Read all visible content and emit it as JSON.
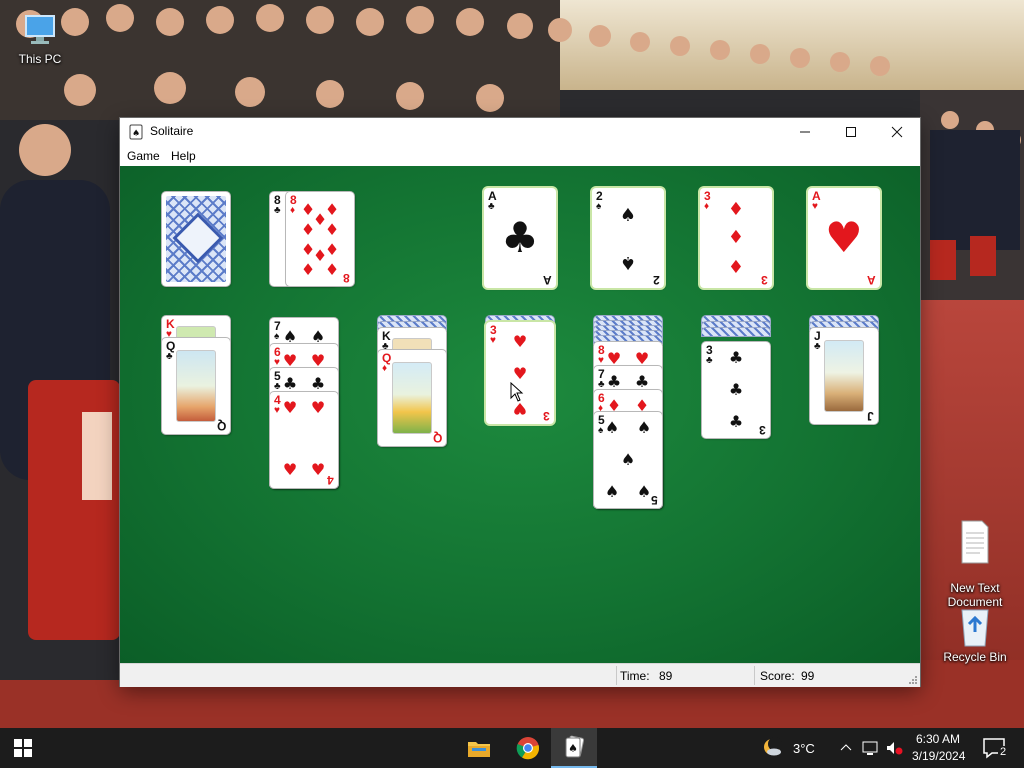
{
  "desktop": {
    "icons": [
      {
        "label": "This PC",
        "icon": "this-pc-icon"
      },
      {
        "label": "New Text\nDocument",
        "icon": "text-document-icon"
      },
      {
        "label": "Recycle Bin",
        "icon": "recycle-bin-icon"
      }
    ]
  },
  "window": {
    "title": "Solitaire",
    "app_icon": "solitaire-card-icon",
    "controls": {
      "minimize": "—",
      "maximize": "☐",
      "close": "✕"
    },
    "menu": [
      "Game",
      "Help"
    ]
  },
  "game": {
    "foundations": [
      {
        "rank": "A",
        "suit": "♣",
        "color": "black"
      },
      {
        "rank": "2",
        "suit": "♠",
        "color": "black"
      },
      {
        "rank": "3",
        "suit": "♦",
        "color": "red"
      },
      {
        "rank": "A",
        "suit": "♥",
        "color": "red"
      }
    ],
    "waste": [
      {
        "rank": "8",
        "suit": "♣"
      },
      {
        "rank": "8",
        "suit": "♦"
      }
    ],
    "tableau": [
      {
        "cards": [
          "K♥",
          "Q♣"
        ]
      },
      {
        "cards": [
          "7♠",
          "6♥",
          "5♣",
          "4♥"
        ]
      },
      {
        "cards": [
          "K♣",
          "Q♦"
        ]
      },
      {
        "cards": [
          "3♥"
        ]
      },
      {
        "cards": [
          "8♥",
          "7♣",
          "6♦",
          "5♠"
        ]
      },
      {
        "cards": [
          "3♣"
        ]
      },
      {
        "cards": [
          "J♣"
        ]
      }
    ]
  },
  "status": {
    "time_label": "Time:",
    "time_value": "89",
    "score_label": "Score:",
    "score_value": "99"
  },
  "taskbar": {
    "apps": [
      "file-explorer-icon",
      "chrome-icon",
      "solitaire-icon"
    ],
    "weather": "3°C",
    "time": "6:30 AM",
    "date": "3/19/2024",
    "notifications": "2"
  }
}
